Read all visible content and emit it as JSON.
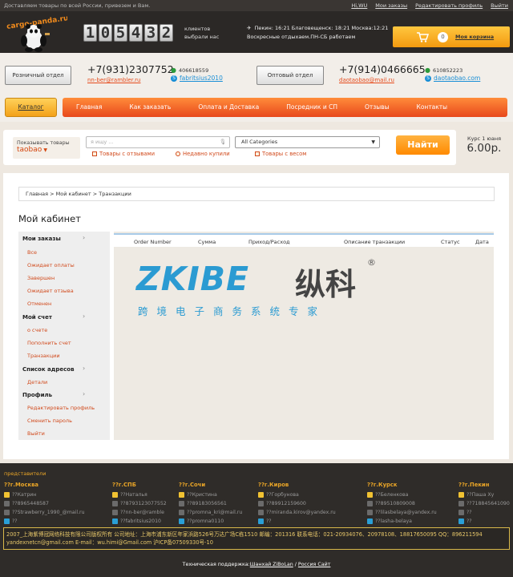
{
  "topbar": {
    "message": "Доставляем товары по всей России, привезем и Вам.",
    "links": [
      "Hi,WU",
      "Мои заказы",
      "Редактировать профиль",
      "Выйти"
    ]
  },
  "header": {
    "logo_text": "cargo-panda.ru",
    "counter_digits": [
      "1",
      "0",
      "5",
      "4",
      "3",
      "2"
    ],
    "counter_label": "клиентов выбрали нас",
    "times": "Пекин: 16:21 Благовещенск: 18:21 Москва:12:21",
    "weekend_note": "Воскресные отдыхаем.ПН-СБ работаем",
    "cart_count": "0",
    "cart_label": "Моя корзина"
  },
  "retail": {
    "button": "Розничный отдел",
    "phone": "+7(931)2307752",
    "email": "nn-ber@rambler.ru",
    "qq": "406618559",
    "skype": "fabritsius2010"
  },
  "wholesale": {
    "button": "Оптовый отдел",
    "phone": "+7(914)0466665",
    "email": "daotaobao@mail.ru",
    "qq": "610852223",
    "skype": "daotaobao.com"
  },
  "nav": {
    "catalog": "Каталог",
    "items": [
      "Главная",
      "Как заказать",
      "Оплата и Доставка",
      "Посредник и СП",
      "Отзывы",
      "Контакты"
    ]
  },
  "search": {
    "shows_label": "Показывать товары",
    "shows_value": "taobao",
    "placeholder": "я ищу ...",
    "category": "All Categories",
    "filters": [
      "Товары с отзывами",
      "Недавно купили",
      "Товары с весом"
    ],
    "button": "Найти",
    "rate_label": "Курс 1 юаня",
    "rate_value": "6.00р."
  },
  "breadcrumb": "Главная  > Мой кабинет  > Транзакции",
  "page_title": "Мой кабинет",
  "sidebar": {
    "orders": {
      "title": "Мои заказы",
      "items": [
        "Все",
        "Ожидает оплаты",
        "Завершен",
        "Ожидает отзыва",
        "Отменен"
      ]
    },
    "account": {
      "title": "Мой счет",
      "items": [
        "о счете",
        "Пополнить счет",
        "Транзакции"
      ]
    },
    "addresses": {
      "title": "Список адресов",
      "items": [
        "Детали"
      ]
    },
    "profile": {
      "title": "Профиль",
      "items": [
        "Редактировать профиль",
        "Сменить пароль",
        "Выйти"
      ]
    }
  },
  "table": {
    "columns": [
      "Order Number",
      "Сумма",
      "Приход/Расход",
      "Описание транзакции",
      "Статус",
      "Дата"
    ]
  },
  "watermark": {
    "brand": "ZKIBE",
    "chinese": "纵科",
    "registered": "®",
    "subtitle": "跨境电子商务系统专家"
  },
  "footer": {
    "reps_title": "представители",
    "cities": [
      {
        "name": "??г.Москва",
        "person": "??Катрин",
        "phone": "??8965448587",
        "mail": "??Strawberry_1990_@mail.ru",
        "skype": "??"
      },
      {
        "name": "??г.СПБ",
        "person": "??Наталья",
        "phone": "??8793123077552",
        "mail": "??nn-ber@ramble",
        "skype": "??fabritsius2010"
      },
      {
        "name": "??г.Сочи",
        "person": "??Кристина",
        "phone": "??89183056561",
        "mail": "??promna_kri@mail.ru",
        "skype": "??promna0110"
      },
      {
        "name": "??г.Киров",
        "person": "??Горбунова",
        "phone": "??89912159600",
        "mail": "??miranda.kirov@yandex.ru",
        "skype": "??"
      },
      {
        "name": "??г.Курск",
        "person": "??Беленкова",
        "phone": "??89510809008",
        "mail": "??lilasbelaya@yandex.ru",
        "skype": "??lasha-belaya"
      },
      {
        "name": "??г.Пекин",
        "person": "??Паша Ху",
        "phone": "??718845641090",
        "mail": "??",
        "skype": "??"
      }
    ],
    "copyright_line1": "2007_上海紫博冠网络科技有限公司版权所有 公司地址：上海市浦东新区年家浜路526号万达广场C栋1510 邮编：201316 联系电话：021-20934076、20978108、18817650095 QQ：896211594",
    "copyright_line2": "yandexnetcn@gmail.com E-mail：wu.himi@Gmail.com 沪ICP备07509330号-10",
    "support_text": "Техническая поддержка:",
    "support_link1": "Шанхай ZiBoLan",
    "support_sep": " / ",
    "support_link2": "Россия Сайт"
  }
}
